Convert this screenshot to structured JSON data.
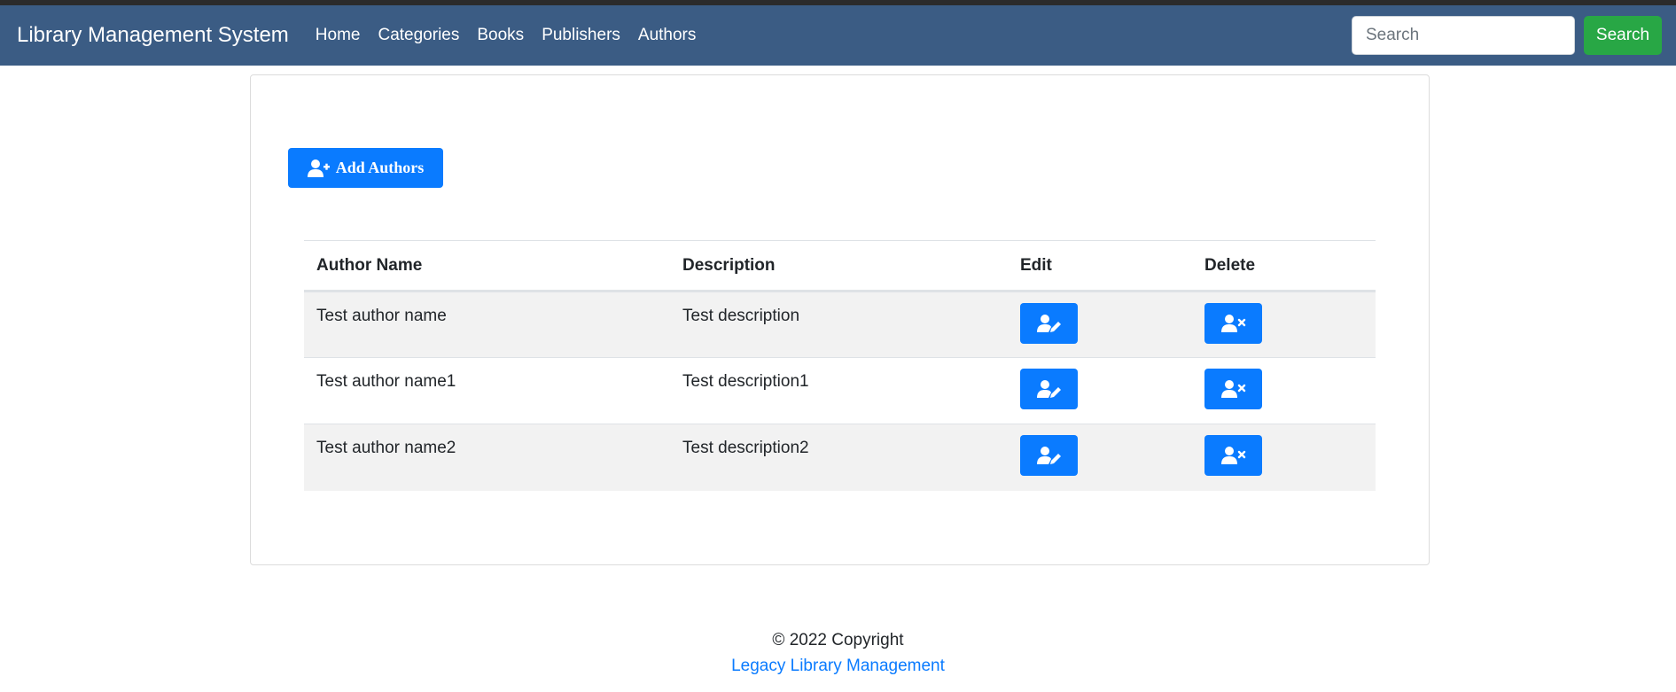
{
  "navbar": {
    "brand": "Library Management System",
    "links": [
      "Home",
      "Categories",
      "Books",
      "Publishers",
      "Authors"
    ],
    "search": {
      "placeholder": "Search",
      "value": "",
      "button_label": "Search"
    }
  },
  "main": {
    "add_button_label": "Add Authors",
    "table": {
      "headers": [
        "Author Name",
        "Description",
        "Edit",
        "Delete"
      ],
      "rows": [
        {
          "name": "Test author name",
          "description": "Test description"
        },
        {
          "name": "Test author name1",
          "description": "Test description1"
        },
        {
          "name": "Test author name2",
          "description": "Test description2"
        }
      ]
    }
  },
  "footer": {
    "copyright": "© 2022 Copyright",
    "link": "Legacy Library Management"
  },
  "colors": {
    "navbar": "#3b5c84",
    "primary": "#0a7bff",
    "success": "#28a745"
  },
  "icons": {
    "add": "user-plus-icon",
    "edit": "user-edit-icon",
    "delete": "user-times-icon"
  }
}
